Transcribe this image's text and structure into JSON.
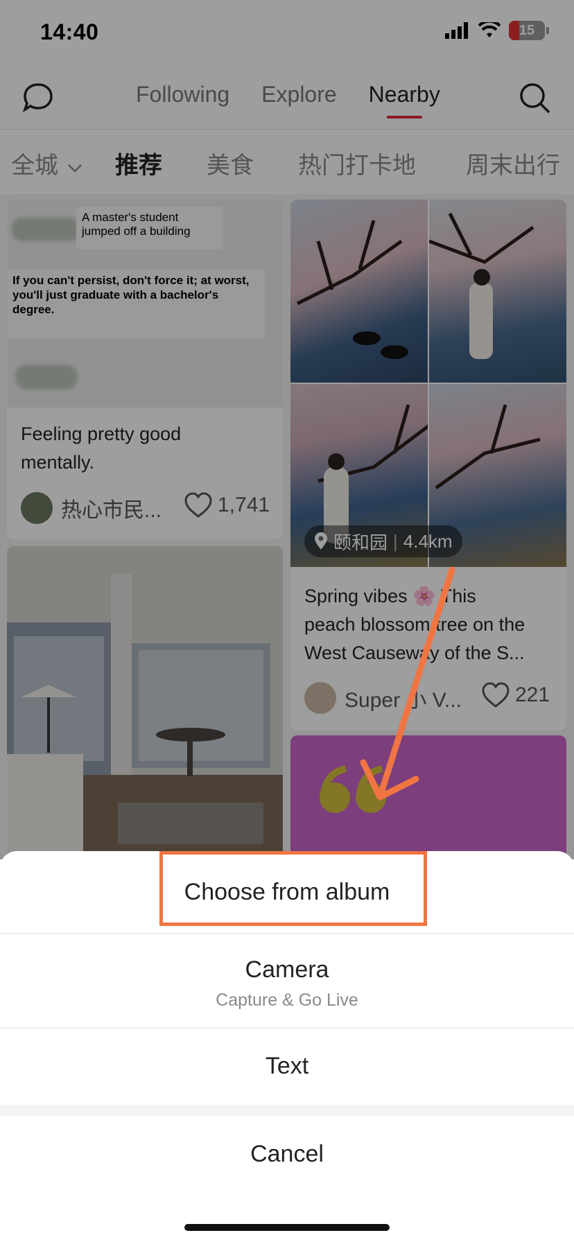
{
  "status_bar": {
    "time": "14:40",
    "battery": "15"
  },
  "top_nav": {
    "tabs": [
      "Following",
      "Explore",
      "Nearby"
    ],
    "active_tab": "Nearby"
  },
  "categories": [
    "全城",
    "推荐",
    "美食",
    "热门打卡地",
    "周末出行"
  ],
  "feed": {
    "post1": {
      "meme_line1": "A master's student jumped off a building",
      "meme_line2": "If you can't persist, don't force it; at worst, you'll just graduate with a bachelor's degree.",
      "title_line1": "Feeling pretty good",
      "title_line2": "mentally.",
      "author": "热心市民...",
      "likes": "1,741"
    },
    "post2": {
      "location": "颐和园",
      "distance": "4.4km",
      "title_line1": "Spring vibes 🌸 This",
      "title_line2": "peach blossom tree on the",
      "title_line3": "West Causeway of the S...",
      "author": "Super 小 V...",
      "likes": "221"
    }
  },
  "sheet": {
    "option1": "Choose from album",
    "option2": "Camera",
    "option2_sub": "Capture & Go Live",
    "option3": "Text",
    "cancel": "Cancel"
  },
  "colors": {
    "accent": "#e3263e",
    "annotation": "#f07543"
  }
}
